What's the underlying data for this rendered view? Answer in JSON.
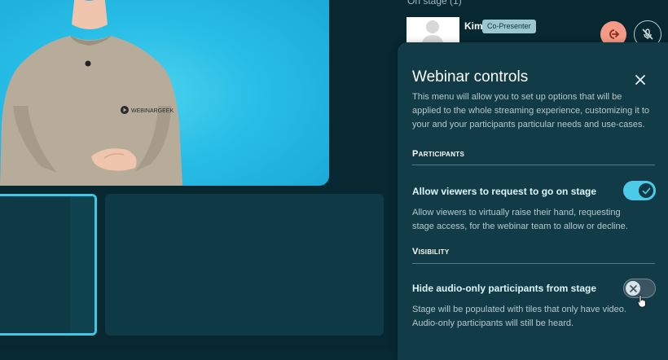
{
  "header": {
    "stage_label": "On stage (1)",
    "participant": {
      "name": "Kim",
      "role": "Co-Presenter"
    }
  },
  "video": {
    "shirt_brand": "WEBINARGEEK"
  },
  "panel": {
    "title": "Webinar controls",
    "description": "This menu will allow you to set up options that will be applied to the whole streaming experience, customizing it to your and your participants particular needs and use-cases.",
    "sections": [
      {
        "heading": "Participants",
        "setting": {
          "label": "Allow viewers to request to go on stage",
          "description": "Allow viewers to virtually raise their hand, requesting stage access, for the webinar team to allow or decline.",
          "enabled": true
        }
      },
      {
        "heading": "Visibility",
        "setting": {
          "label": "Hide audio-only participants from stage",
          "description": "Stage will be populated with tiles that only have video. Audio-only participants will still be heard.",
          "enabled": false
        }
      }
    ]
  },
  "colors": {
    "background": "#072831",
    "panel": "#113c47",
    "accent": "#4ccbe8",
    "leave_button": "#f49a86"
  },
  "icons": {
    "leave": "leave-icon",
    "mute": "mic-off-icon",
    "close": "close-icon",
    "check": "check-icon",
    "toggle_x": "x-icon",
    "cursor": "pointer-hand-icon"
  }
}
